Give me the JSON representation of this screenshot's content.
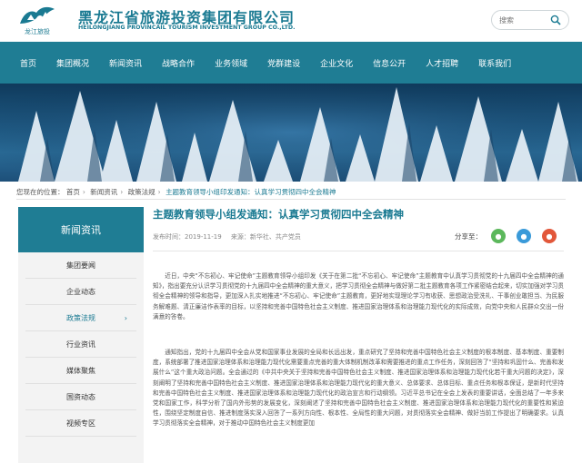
{
  "header": {
    "logo_text": "龙江旅投",
    "company_cn": "黑龙江省旅游投资集团有限公司",
    "company_en": "HEILONGJIANG PROVINCAIL TOURISM INVESTMENT GROUP CO.,LTD.",
    "search_placeholder": "搜索"
  },
  "nav": [
    "首页",
    "集团概况",
    "新闻资讯",
    "战略合作",
    "业务领域",
    "党群建设",
    "企业文化",
    "信息公开",
    "人才招聘",
    "联系我们"
  ],
  "breadcrumb": {
    "prefix": "您现在的位置：",
    "items": [
      "首页",
      "新闻资讯",
      "政策法规"
    ],
    "current": "主题教育领导小组印发通知：认真学习贯彻四中全会精神"
  },
  "sidebar": {
    "title": "新闻资讯",
    "items": [
      "集团要闻",
      "企业动态",
      "政策法规",
      "行业资讯",
      "媒体聚焦",
      "国资动态",
      "视频专区"
    ],
    "active_arrow": "›"
  },
  "article": {
    "title": "主题教育领导小组发通知：认真学习贯彻四中全会精神",
    "date": "发布时间：2019-11-19",
    "source": "来源：新华社、共产党员",
    "share_label": "分享至：",
    "paragraph1": "近日，中央“不忘初心、牢记使命”主题教育领导小组印发《关于在第二批“不忘初心、牢记使命”主题教育中认真学习贯彻党的十九届四中全会精神的通知》，指出要充分认识学习贯彻党的十九届四中全会精神的重大意义，把学习贯彻全会精神与做好第二批主题教育各项工作紧密结合起来，切实加强对学习贯彻全会精神的领导和指导，更加深入扎实地推进“不忘初心、牢记使命”主题教育，更好地实现理论学习有收获、思想政治受洗礼、干事创业敢担当、为民服务解难题、清正廉洁作表率的目标，以坚持和完善中国特色社会主义制度、推进国家治理体系和治理能力现代化的实际成效，向党中央和人民群众交出一份满意的答卷。",
    "paragraph2": "通知指出，党的十九届四中全会从党和国家事业发展的全局和长远出发，重点研究了坚持和完善中国特色社会主义制度的根本制度、基本制度、重要制度，系统部署了推进国家治理体系和治理能力现代化需要重点完善的重大体制机制改革和需要推进的重点工作任务，深刻回答了“坚持和巩固什么、完善和发展什么”这个重大政治问题。全会通过的《中共中央关于坚持和完善中国特色社会主义制度、推进国家治理体系和治理能力现代化若干重大问题的决定》，深刻阐明了坚持和完善中国特色社会主义制度、推进国家治理体系和治理能力现代化的重大意义、总体要求、总体目标、重点任务和根本保证，是新时代坚持和完善中国特色社会主义制度、推进国家治理体系和治理能力现代化的政治宣言和行动纲领。习近平总书记在全会上发表的重要讲话，全面总结了一年多来党和国家工作，科学分析了国内外形势的发展变化，深刻阐述了坚持和完善中国特色社会主义制度、推进国家治理体系和治理能力现代化的重要性和紧迫性，围绕坚定制度自信、推进制度落实深入回答了一系列方向性、根本性、全局性的重大问题，对贯彻落实全会精神、做好当前工作提出了明确要求。认真学习贯彻落实全会精神，对于推动中国特色社会主义制度更加"
  },
  "colors": {
    "brand": "#1f7d94",
    "title": "#1a7a92",
    "wechat": "#5cb85c",
    "qq": "#3a9ad9",
    "weibo": "#e2573a"
  }
}
